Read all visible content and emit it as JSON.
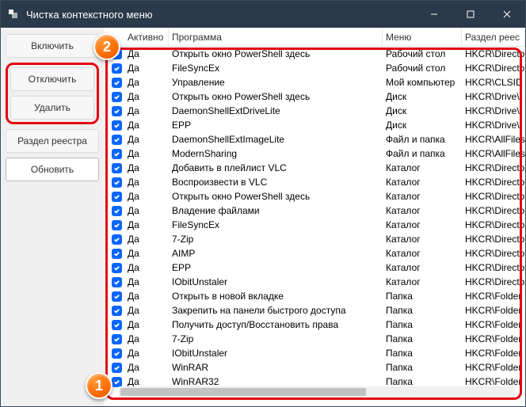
{
  "titlebar": {
    "title": "Чистка контекстного меню"
  },
  "sidebar": {
    "enable": "Включить",
    "disable": "Отключить",
    "delete": "Удалить",
    "registry": "Раздел реестра",
    "refresh": "Обновить"
  },
  "headers": {
    "active": "Активно",
    "program": "Программа",
    "menu": "Меню",
    "registry": "Раздел реес"
  },
  "yes": "Да",
  "rows": [
    {
      "prog": "Открыть окно PowerShell здесь",
      "menu": "Рабочий стол",
      "reg": "HKCR\\Directo"
    },
    {
      "prog": " FileSyncEx",
      "menu": "Рабочий стол",
      "reg": "HKCR\\Directo"
    },
    {
      "prog": "Управление",
      "menu": "Мой компьютер",
      "reg": "HKCR\\CLSID"
    },
    {
      "prog": "Открыть окно PowerShell здесь",
      "menu": "Диск",
      "reg": "HKCR\\Drive\\"
    },
    {
      "prog": "DaemonShellExtDriveLite",
      "menu": "Диск",
      "reg": "HKCR\\Drive\\"
    },
    {
      "prog": "EPP",
      "menu": "Диск",
      "reg": "HKCR\\Drive\\"
    },
    {
      "prog": "DaemonShellExtImageLite",
      "menu": "Файл и папка",
      "reg": "HKCR\\AllFiles"
    },
    {
      "prog": "ModernSharing",
      "menu": "Файл и папка",
      "reg": "HKCR\\AllFiles"
    },
    {
      "prog": "Добавить в плейлист VLC",
      "menu": "Каталог",
      "reg": "HKCR\\Directo"
    },
    {
      "prog": "Воспроизвести в VLC",
      "menu": "Каталог",
      "reg": "HKCR\\Directo"
    },
    {
      "prog": "Открыть окно PowerShell здесь",
      "menu": "Каталог",
      "reg": "HKCR\\Directo"
    },
    {
      "prog": "Владение файлами",
      "menu": "Каталог",
      "reg": "HKCR\\Directo"
    },
    {
      "prog": " FileSyncEx",
      "menu": "Каталог",
      "reg": "HKCR\\Directo"
    },
    {
      "prog": "7-Zip",
      "menu": "Каталог",
      "reg": "HKCR\\Directo"
    },
    {
      "prog": "AIMP",
      "menu": "Каталог",
      "reg": "HKCR\\Directo"
    },
    {
      "prog": "EPP",
      "menu": "Каталог",
      "reg": "HKCR\\Directo"
    },
    {
      "prog": "IObitUnstaler",
      "menu": "Каталог",
      "reg": "HKCR\\Directo"
    },
    {
      "prog": "Открыть в новой вкладке",
      "menu": "Папка",
      "reg": "HKCR\\Folder"
    },
    {
      "prog": "Закрепить на панели быстрого доступа",
      "menu": "Папка",
      "reg": "HKCR\\Folder"
    },
    {
      "prog": "Получить доступ/Восстановить права",
      "menu": "Папка",
      "reg": "HKCR\\Folder"
    },
    {
      "prog": "7-Zip",
      "menu": "Папка",
      "reg": "HKCR\\Folder"
    },
    {
      "prog": "IObitUnstaler",
      "menu": "Папка",
      "reg": "HKCR\\Folder"
    },
    {
      "prog": "WinRAR",
      "menu": "Папка",
      "reg": "HKCR\\Folder"
    },
    {
      "prog": "WinRAR32",
      "menu": "Папка",
      "reg": "HKCR\\Folder"
    }
  ],
  "markers": {
    "one": "1",
    "two": "2"
  }
}
